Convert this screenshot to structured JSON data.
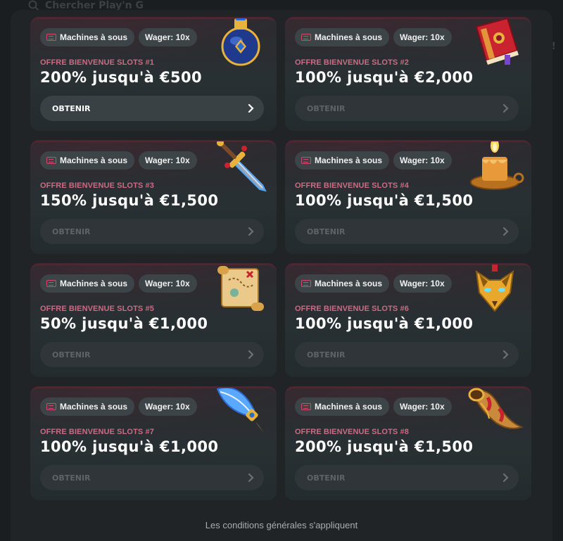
{
  "background": {
    "search_placeholder": "Chercher Play'n G",
    "right_text": "i!"
  },
  "offers": [
    {
      "tag_category": "Machines à sous",
      "tag_wager": "Wager: 10x",
      "label": "OFFRE BIENVENUE SLOTS #1",
      "title": "200% jusqu'à €500",
      "cta": "OBTENIR",
      "art": "potion-icon",
      "active": true
    },
    {
      "tag_category": "Machines à sous",
      "tag_wager": "Wager: 10x",
      "label": "OFFRE BIENVENUE SLOTS #2",
      "title": "100% jusqu'à €2,000",
      "cta": "OBTENIR",
      "art": "spellbook-icon",
      "active": false
    },
    {
      "tag_category": "Machines à sous",
      "tag_wager": "Wager: 10x",
      "label": "OFFRE BIENVENUE SLOTS #3",
      "title": "150% jusqu'à €1,500",
      "cta": "OBTENIR",
      "art": "dagger-icon",
      "active": false
    },
    {
      "tag_category": "Machines à sous",
      "tag_wager": "Wager: 10x",
      "label": "OFFRE BIENVENUE SLOTS #4",
      "title": "100% jusqu'à €1,500",
      "cta": "OBTENIR",
      "art": "candle-icon",
      "active": false
    },
    {
      "tag_category": "Machines à sous",
      "tag_wager": "Wager: 10x",
      "label": "OFFRE BIENVENUE SLOTS #5",
      "title": "50% jusqu'à €1,000",
      "cta": "OBTENIR",
      "art": "treasure-map-icon",
      "active": false
    },
    {
      "tag_category": "Machines à sous",
      "tag_wager": "Wager: 10x",
      "label": "OFFRE BIENVENUE SLOTS #6",
      "title": "100% jusqu'à €1,000",
      "cta": "OBTENIR",
      "art": "fox-mask-icon",
      "active": false
    },
    {
      "tag_category": "Machines à sous",
      "tag_wager": "Wager: 10x",
      "label": "OFFRE BIENVENUE SLOTS #7",
      "title": "100% jusqu'à €1,000",
      "cta": "OBTENIR",
      "art": "feather-quill-icon",
      "active": false
    },
    {
      "tag_category": "Machines à sous",
      "tag_wager": "Wager: 10x",
      "label": "OFFRE BIENVENUE SLOTS #8",
      "title": "200% jusqu'à €1,500",
      "cta": "OBTENIR",
      "art": "horn-icon",
      "active": false
    }
  ],
  "footer": "Les conditions générales s'appliquent"
}
